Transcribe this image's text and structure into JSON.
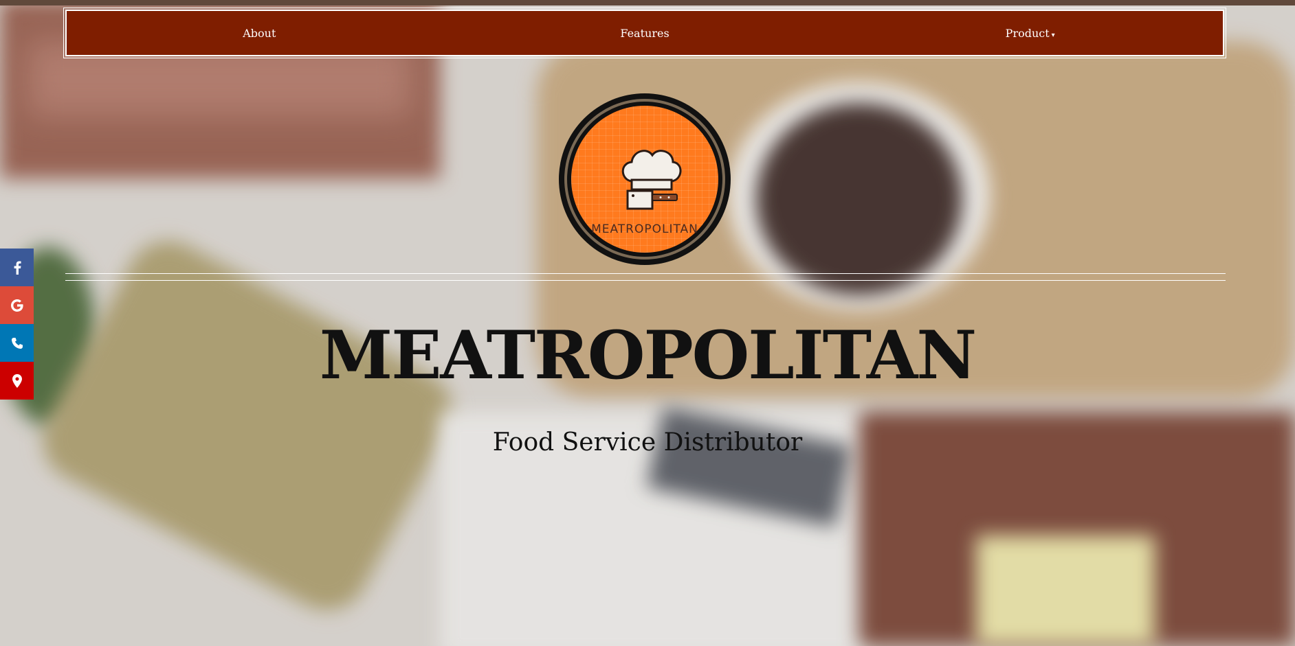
{
  "nav": {
    "about": "About",
    "features": "Features",
    "product": "Product",
    "product_caret": "▾"
  },
  "logo": {
    "text": "MEATROPOLITAN",
    "icon": "chef-hat-cleaver-icon"
  },
  "hero": {
    "title": "MEATROPOLITAN",
    "subtitle": "Food Service Distributor"
  },
  "social": [
    {
      "icon": "facebook-icon",
      "color": "#3b5998"
    },
    {
      "icon": "google-icon",
      "color": "#dd4b39"
    },
    {
      "icon": "phone-icon",
      "color": "#0077b5"
    },
    {
      "icon": "map-marker-icon",
      "color": "#cc0000"
    }
  ],
  "colors": {
    "navbar": "#7f1e00",
    "logo_orange": "#ff7a1e"
  }
}
